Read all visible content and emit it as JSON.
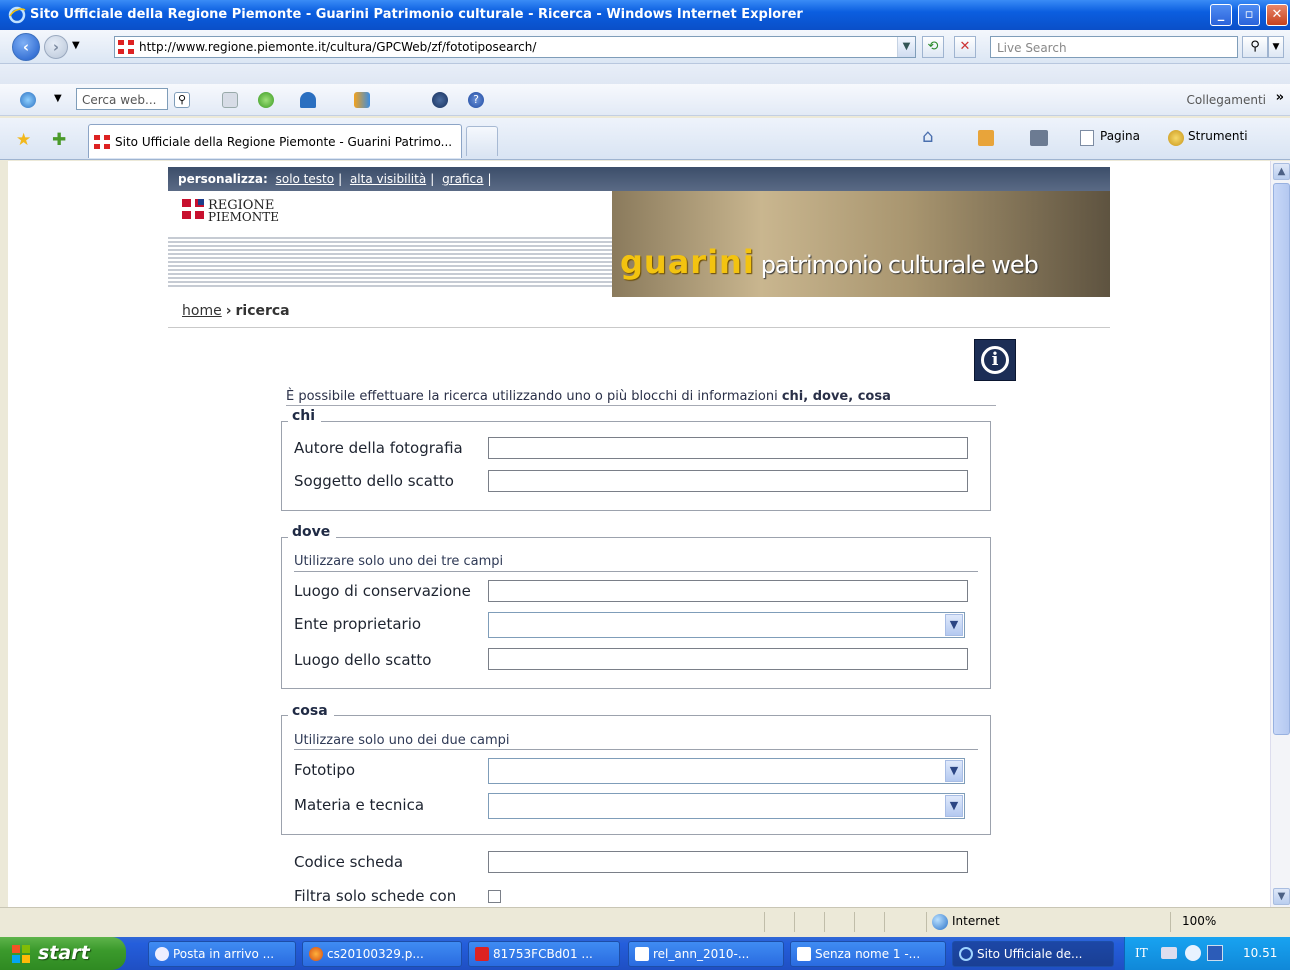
{
  "window": {
    "title": "Sito Ufficiale della Regione Piemonte - Guarini Patrimonio culturale - Ricerca - Windows Internet Explorer",
    "minimize_glyph": "_",
    "maximize_glyph": "▫",
    "close_glyph": "✕"
  },
  "address_bar": {
    "url": "http://www.regione.piemonte.it/cultura/GPCWeb/zf/fototiposearch/",
    "live_search_placeholder": "Live Search"
  },
  "toolbar": {
    "cerca_web_placeholder": "Cerca web...",
    "collegamenti": "Collegamenti",
    "more": "»"
  },
  "tabs": {
    "active_title": "Sito Ufficiale della Regione Piemonte - Guarini Patrimo...",
    "pagina": "Pagina",
    "strumenti": "Strumenti"
  },
  "page": {
    "personalizza_label": "personalizza:",
    "personalizza_links": [
      "solo testo",
      "alta visibilità",
      "grafica"
    ],
    "logo_line1": "REGIONE",
    "logo_line2": "PIEMONTE",
    "banner_guarini": "guarini",
    "banner_rest": "patrimonio culturale web",
    "breadcrumb_home": "home",
    "breadcrumb_sep": "›",
    "breadcrumb_current": "ricerca",
    "info_glyph": "i",
    "intro_text": "È possibile effettuare la ricerca utilizzando uno o più blocchi di informazioni ",
    "intro_bold": "chi, dove, cosa"
  },
  "form": {
    "chi": {
      "legend": "chi",
      "autore_label": "Autore della fotografia",
      "soggetto_label": "Soggetto dello scatto"
    },
    "dove": {
      "legend": "dove",
      "hint": "Utilizzare solo uno dei tre campi",
      "luogo_conservazione_label": "Luogo di conservazione",
      "ente_label": "Ente proprietario",
      "luogo_scatto_label": "Luogo dello scatto"
    },
    "cosa": {
      "legend": "cosa",
      "hint": "Utilizzare solo uno dei due campi",
      "fototipo_label": "Fototipo",
      "materia_label": "Materia e tecnica"
    },
    "codice_label": "Codice scheda",
    "filtra_label": "Filtra solo schede con"
  },
  "status_bar": {
    "zone": "Internet",
    "zoom": "100%"
  },
  "taskbar": {
    "start": "start",
    "items": [
      "Posta in arrivo ...",
      "cs20100329.p...",
      "81753FCBd01 ...",
      "rel_ann_2010-...",
      "Senza nome 1 -...",
      "Sito Ufficiale de..."
    ],
    "lang": "IT",
    "clock": "10.51"
  }
}
